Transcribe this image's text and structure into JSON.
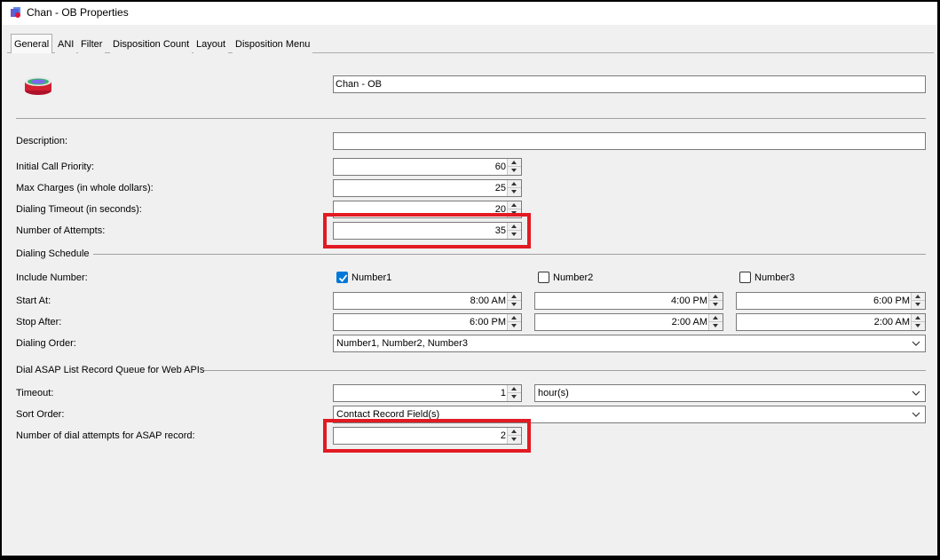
{
  "window": {
    "title": "Chan - OB Properties"
  },
  "tabs": [
    "General",
    "ANI",
    "Filter",
    "Disposition Count",
    "Layout",
    "Disposition Menu"
  ],
  "general": {
    "name_value": "Chan - OB",
    "description_label": "Description:",
    "description_value": "",
    "initial_priority": {
      "label": "Initial Call Priority:",
      "value": "60"
    },
    "max_charges": {
      "label": "Max Charges (in whole dollars):",
      "value": "25"
    },
    "dialing_timeout": {
      "label": "Dialing Timeout (in seconds):",
      "value": "20"
    },
    "num_attempts": {
      "label": "Number of Attempts:",
      "value": "35"
    }
  },
  "schedule": {
    "heading": "Dialing Schedule",
    "include_label": "Include Number:",
    "numbers": [
      {
        "label": "Number1",
        "checked": true
      },
      {
        "label": "Number2",
        "checked": false
      },
      {
        "label": "Number3",
        "checked": false
      }
    ],
    "start_label": "Start At:",
    "start_times": [
      "8:00 AM",
      "4:00 PM",
      "6:00 PM"
    ],
    "stop_label": "Stop After:",
    "stop_times": [
      "6:00 PM",
      "2:00 AM",
      "2:00 AM"
    ],
    "order_label": "Dialing Order:",
    "order_value": "Number1, Number2, Number3"
  },
  "asap": {
    "heading": "Dial ASAP List Record Queue for Web APIs",
    "timeout_label": "Timeout:",
    "timeout_value": "1",
    "timeout_unit": "hour(s)",
    "sort_label": "Sort Order:",
    "sort_value": "Contact Record Field(s)",
    "attempts_label": "Number of dial attempts for ASAP record:",
    "attempts_value": "2"
  },
  "colors": {
    "highlight": "#e21a23",
    "checkbox_on": "#0078d7"
  }
}
